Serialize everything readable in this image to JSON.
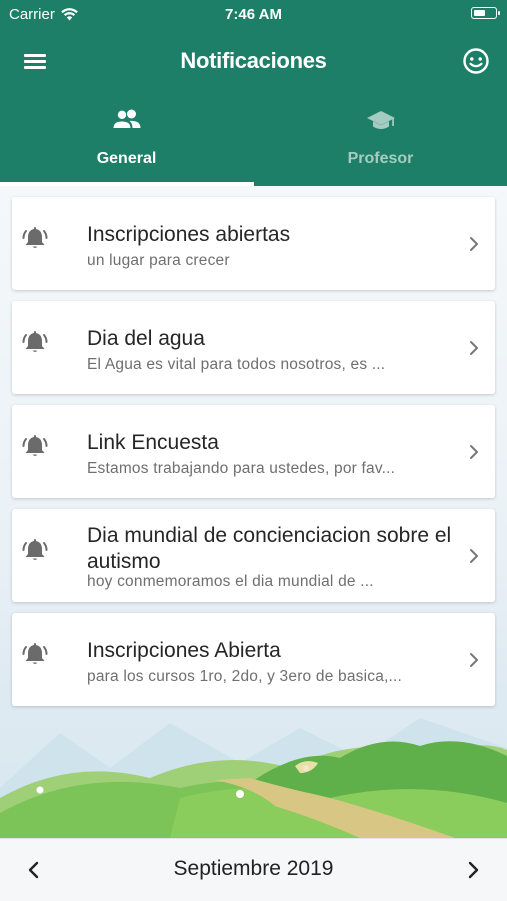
{
  "status_bar": {
    "carrier": "Carrier",
    "time": "7:46 AM",
    "battery_level": 0.55
  },
  "app_bar": {
    "title": "Notificaciones",
    "menu_icon": "menu-icon",
    "profile_icon": "face-icon"
  },
  "tabs": [
    {
      "label": "General",
      "icon": "group-icon",
      "active": true
    },
    {
      "label": "Profesor",
      "icon": "graduation-cap-icon",
      "active": false
    }
  ],
  "notifications": [
    {
      "title": "Inscripciones abiertas",
      "subtitle": "un lugar para crecer"
    },
    {
      "title": "Dia del agua",
      "subtitle": "El Agua es vital para todos nosotros, es ..."
    },
    {
      "title": "Link Encuesta",
      "subtitle": "Estamos trabajando para ustedes, por fav..."
    },
    {
      "title": "Dia mundial de concienciacion sobre el autismo",
      "subtitle": "hoy conmemoramos el dia mundial de ..."
    },
    {
      "title": "Inscripciones Abierta",
      "subtitle": "para los cursos 1ro, 2do, y 3ero de basica,..."
    }
  ],
  "footer": {
    "month_label": "Septiembre 2019"
  },
  "colors": {
    "primary": "#1e7f68",
    "card_background": "#ffffff",
    "footer_background": "#f6f7f8"
  }
}
